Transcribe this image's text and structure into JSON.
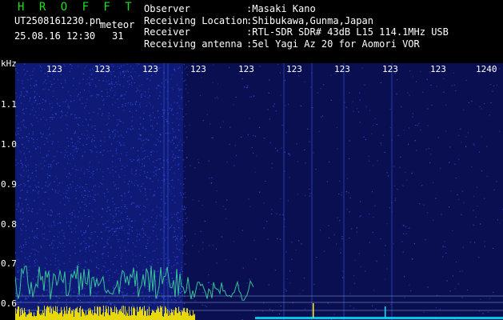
{
  "header": {
    "brand": "H R O F F T",
    "filename": "UT2508161230.pn",
    "tag": "meteor",
    "datetime": "25.08.16 12:30",
    "count": "31"
  },
  "info": [
    {
      "label": "Observer",
      "value": ":Masaki Kano"
    },
    {
      "label": "Receiving Location",
      "value": ":Shibukawa,Gunma,Japan"
    },
    {
      "label": "Receiver",
      "value": ":RTL-SDR SDR# 43dB L15 114.1MHz USB"
    },
    {
      "label": "Receiving antenna",
      "value": ":5el Yagi Az 20 for Aomori VOR"
    }
  ],
  "axes": {
    "unit": "kHz",
    "y_ticks": [
      "1.1",
      "1.0",
      "0.9",
      "0.8",
      "0.7",
      "0.6"
    ],
    "x_ticks": [
      "123",
      "123",
      "123",
      "123",
      "123",
      "123",
      "123",
      "123",
      "123",
      "1240"
    ]
  },
  "colors": {
    "background": "#0a0f52",
    "noise": "#3a5cff",
    "echo": "#40e0a0",
    "strong": "#ffee00",
    "baseline": "#00e5ff"
  }
}
